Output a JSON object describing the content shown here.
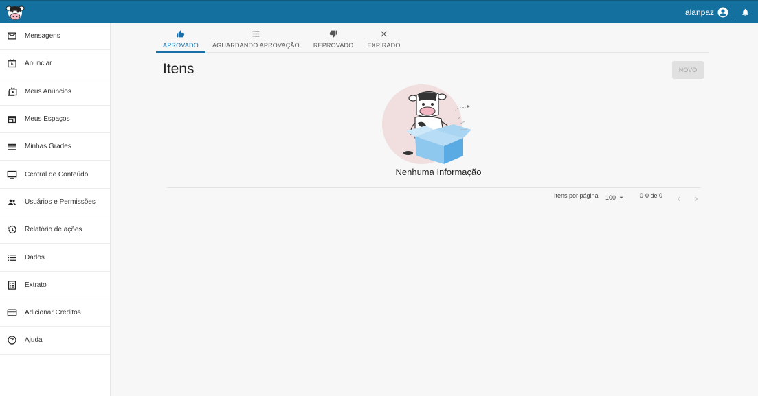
{
  "header": {
    "username": "alanpaz"
  },
  "sidebar": {
    "items": [
      {
        "label": "Mensagens",
        "icon": "mail-icon"
      },
      {
        "label": "Anunciar",
        "icon": "play-box-icon"
      },
      {
        "label": "Meus Anúncios",
        "icon": "video-library-icon"
      },
      {
        "label": "Meus Espaços",
        "icon": "store-icon"
      },
      {
        "label": "Minhas Grades",
        "icon": "list-lines-icon"
      },
      {
        "label": "Central de Conteúdo",
        "icon": "monitor-icon"
      },
      {
        "label": "Usuários e Permissões",
        "icon": "group-icon"
      },
      {
        "label": "Relatório de ações",
        "icon": "history-icon"
      },
      {
        "label": "Dados",
        "icon": "list-icon"
      },
      {
        "label": "Extrato",
        "icon": "receipt-icon"
      },
      {
        "label": "Adicionar Créditos",
        "icon": "credit-card-icon"
      },
      {
        "label": "Ajuda",
        "icon": "help-icon"
      }
    ]
  },
  "tabs": [
    {
      "label": "APROVADO",
      "icon": "thumb-up-icon",
      "active": true
    },
    {
      "label": "AGUARDANDO APROVAÇÃO",
      "icon": "list-icon",
      "active": false
    },
    {
      "label": "REPROVADO",
      "icon": "thumb-down-icon",
      "active": false
    },
    {
      "label": "EXPIRADO",
      "icon": "close-icon",
      "active": false
    }
  ],
  "page": {
    "title": "Itens",
    "new_label": "NOVO",
    "empty_text": "Nenhuma Informação"
  },
  "pagination": {
    "per_page_label": "Itens por página",
    "per_page_value": "100",
    "range": "0-0 de 0"
  },
  "colors": {
    "header": "#14709e",
    "accent": "#1a6fa8"
  }
}
